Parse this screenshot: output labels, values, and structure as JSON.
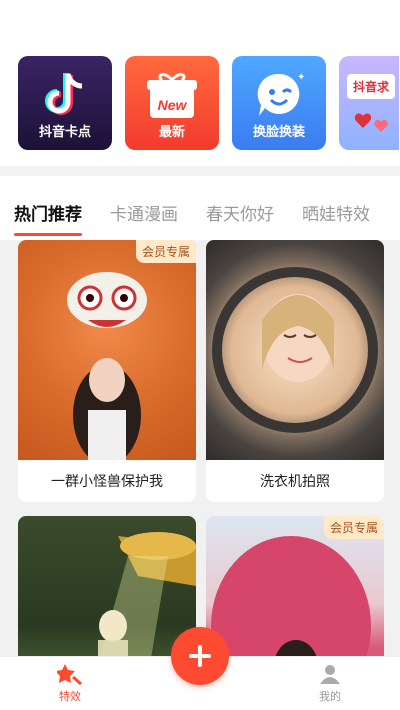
{
  "features": [
    {
      "label": "抖音卡点",
      "icon": "tiktok-note-icon"
    },
    {
      "label": "最新",
      "icon": "gift-new-icon",
      "icon_text": "New"
    },
    {
      "label": "换脸换装",
      "icon": "wink-face-icon"
    },
    {
      "label": "",
      "sign_text": "抖音求",
      "icon": "hearts-sign-icon"
    }
  ],
  "tabs": [
    {
      "label": "热门推荐",
      "active": true
    },
    {
      "label": "卡通漫画",
      "active": false
    },
    {
      "label": "春天你好",
      "active": false
    },
    {
      "label": "晒娃特效",
      "active": false
    }
  ],
  "cards": [
    {
      "caption": "一群小怪兽保护我",
      "badge": "会员专属"
    },
    {
      "caption": "洗衣机拍照",
      "badge": ""
    },
    {
      "caption": "",
      "badge": ""
    },
    {
      "caption": "",
      "badge": "会员专属"
    }
  ],
  "bottom_nav": {
    "effects_label": "特效",
    "mine_label": "我的",
    "fab_icon": "plus-icon"
  },
  "colors": {
    "accent": "#ff4a32",
    "badge_bg": "#ffe9c9",
    "badge_text": "#a0561f"
  }
}
